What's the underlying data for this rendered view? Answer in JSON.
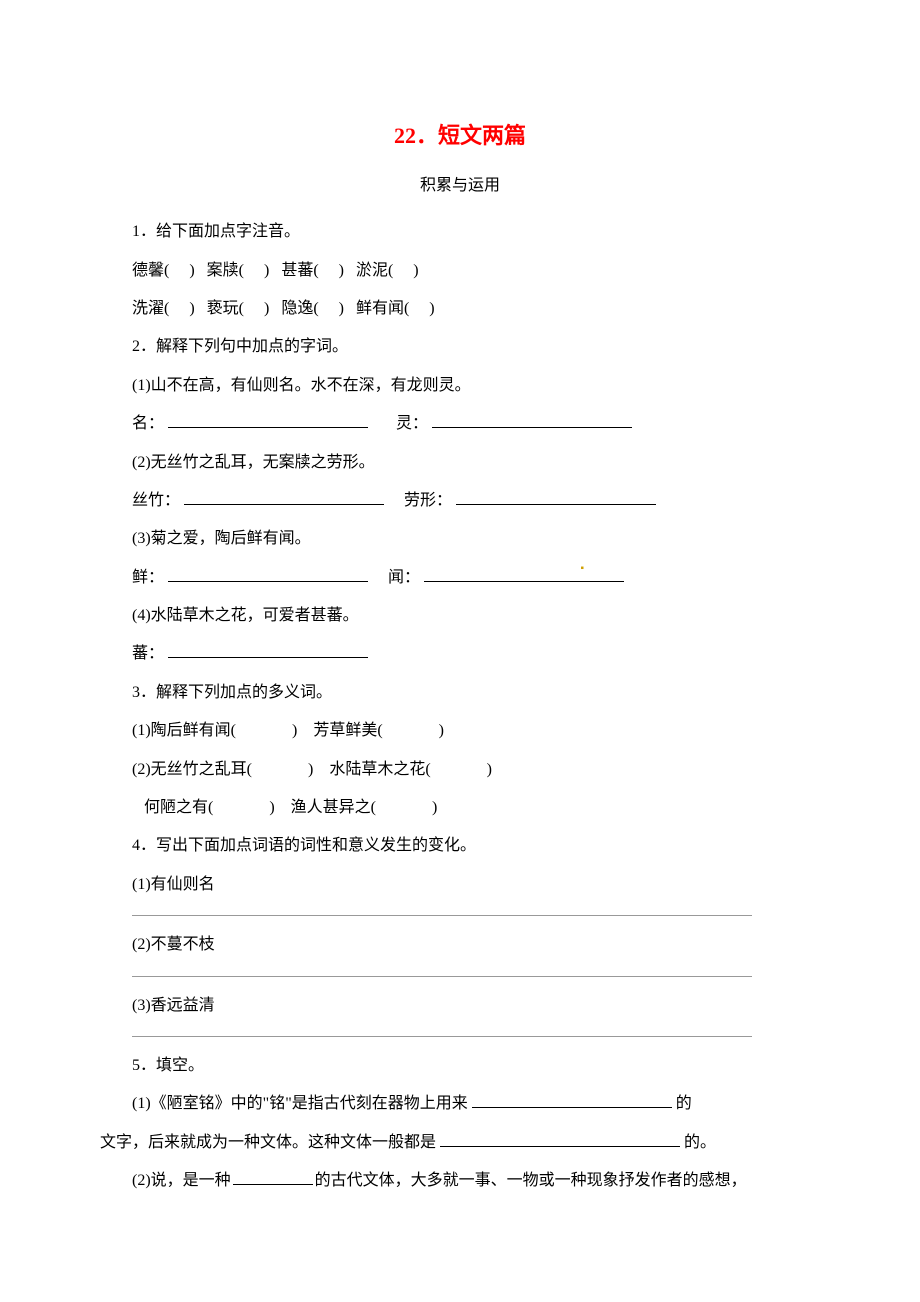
{
  "title": "22．短文两篇",
  "subtitle": "积累与运用",
  "q1": {
    "header": "1．给下面加点字注音。",
    "row1": "德馨(     )   案牍(     )   甚蕃(     )   淤泥(     )",
    "row2": "洗濯(     )   亵玩(     )   隐逸(     )   鲜有闻(     )"
  },
  "q2": {
    "header": "2．解释下列句中加点的字词。",
    "i1": "(1)山不在高，有仙则名。水不在深，有龙则灵。",
    "i1a": "名：",
    "i1b": "灵：",
    "i2": "(2)无丝竹之乱耳，无案牍之劳形。",
    "i2a": "丝竹：",
    "i2b": "劳形：",
    "i3": "(3)菊之爱，陶后鲜有闻。",
    "i3a": "鲜：",
    "i3b": "闻：",
    "i4": "(4)水陆草木之花，可爱者甚蕃。",
    "i4a": "蕃："
  },
  "q3": {
    "header": "3．解释下列加点的多义词。",
    "i1": "(1)陶后鲜有闻(              )    芳草鲜美(              )",
    "i2": "(2)无丝竹之乱耳(              )    水陆草木之花(              )",
    "i2b": "   何陋之有(              )    渔人甚异之(              )"
  },
  "q4": {
    "header": "4．写出下面加点词语的词性和意义发生的变化。",
    "i1": "(1)有仙则名",
    "i2": "(2)不蔓不枝",
    "i3": "(3)香远益清"
  },
  "q5": {
    "header": "5．填空。",
    "i1a": "(1)《陋室铭》中的\"铭\"是指古代刻在器物上用来",
    "i1b": "的",
    "i1c": "文字，后来就成为一种文体。这种文体一般都是",
    "i1d": "的。",
    "i2a": "(2)说，是一种",
    "i2b": "的古代文体，大多就一事、一物或一种现象抒发作者的感想，"
  }
}
